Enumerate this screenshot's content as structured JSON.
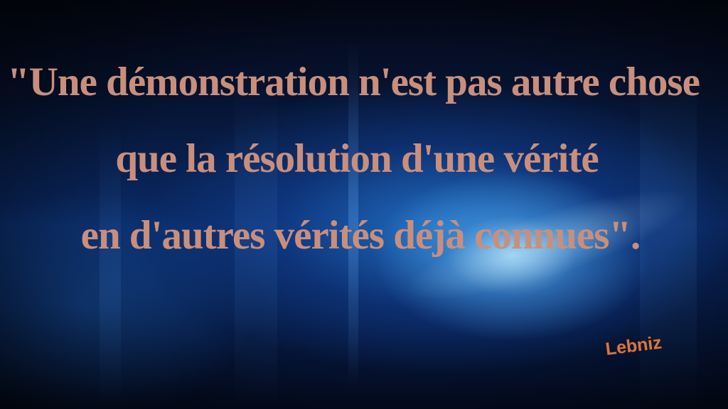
{
  "quote": {
    "lines": [
      "\"Une démonstration n'est pas autre chose",
      "que la résolution d'une vérité",
      "en d'autres vérités déjà connues\"."
    ]
  },
  "author": "Lebniz",
  "colors": {
    "text": "#c98f7c",
    "text_outline": "#3a1a12",
    "author_text": "#c77a5c",
    "background_dark": "#040817",
    "background_glow": "#aae1ff"
  }
}
